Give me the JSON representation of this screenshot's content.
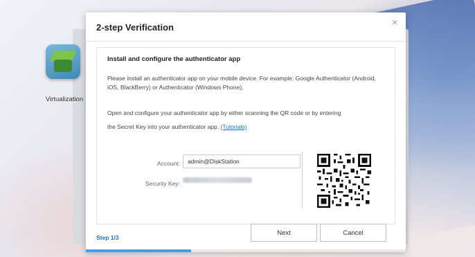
{
  "desktop": {
    "app_icon_label": "Virtualization"
  },
  "dialog": {
    "title": "2-step Verification",
    "close_symbol": "×",
    "section_title": "Install and configure the authenticator app",
    "paragraph1": "Please install an authenticator app on your mobile device. For example: Google Authenticator (Android, iOS, BlackBerry) or Authenticator (Windows Phone).",
    "paragraph2_line1": "Open and configure your authenticator app by either scanning the QR code or by entering",
    "paragraph2_line2": "the Secret Key into your authenticator app.",
    "paragraph2_link": "(Tutorials)",
    "account_label": "Account:",
    "account_value": "admin@DiskStation",
    "security_key_label": "Security Key:",
    "step_text": "Step 1/3",
    "next_label": "Next",
    "cancel_label": "Cancel",
    "progress": 0.33
  },
  "colors": {
    "link": "#1b6ec2",
    "progress": "#3ea3e3"
  },
  "icons": {
    "close": "close-icon",
    "app": "virtualization-icon",
    "qr": "qr-code"
  }
}
